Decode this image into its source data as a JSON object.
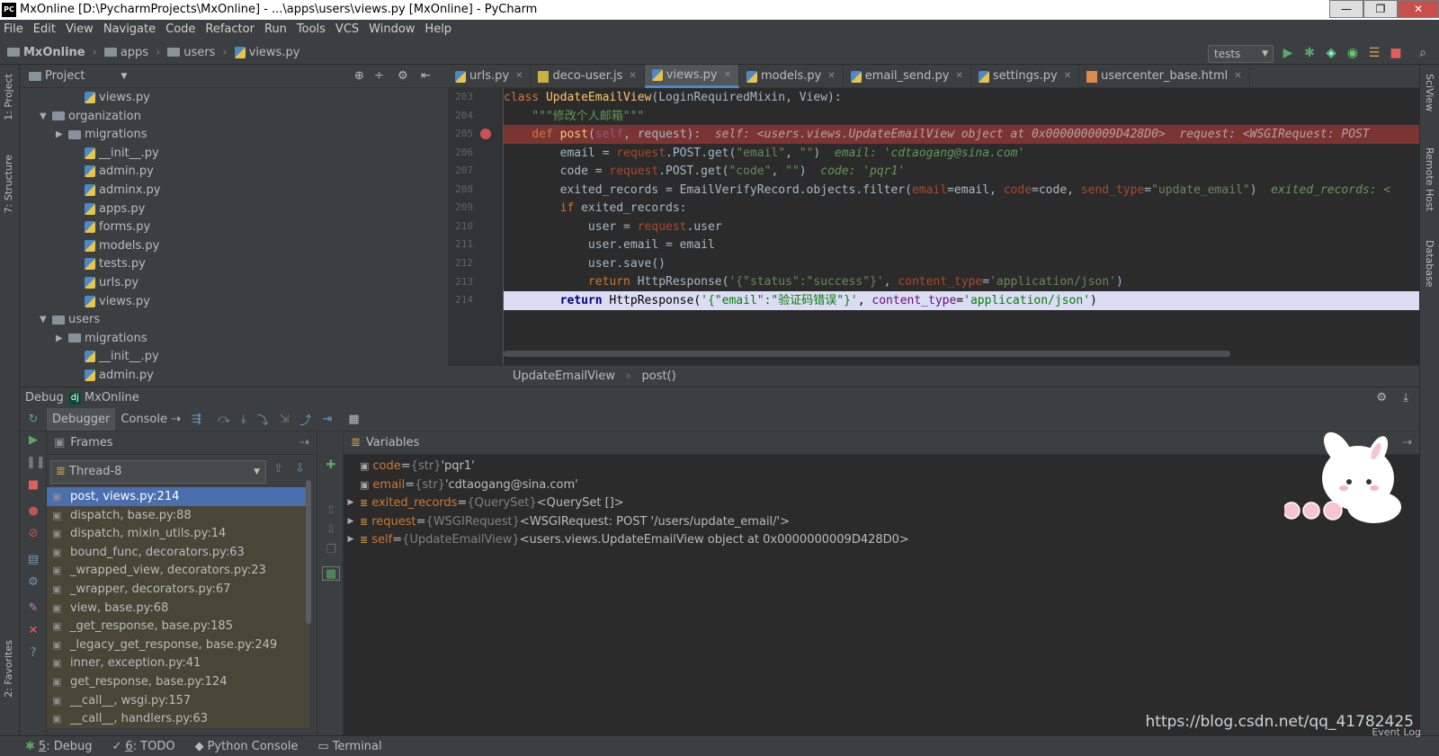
{
  "window": {
    "title": "MxOnline [D:\\PycharmProjects\\MxOnline] - ...\\apps\\users\\views.py [MxOnline] - PyCharm",
    "logo": "PC",
    "min": "—",
    "max": "❐",
    "close": "✕"
  },
  "menu": [
    "File",
    "Edit",
    "View",
    "Navigate",
    "Code",
    "Refactor",
    "Run",
    "Tools",
    "VCS",
    "Window",
    "Help"
  ],
  "breadcrumb": [
    "MxOnline",
    "apps",
    "users",
    "views.py"
  ],
  "run_config": "tests",
  "left_strip": {
    "project": "1: Project",
    "structure": "7: Structure",
    "favorites": "2: Favorites"
  },
  "right_strip": {
    "sciview": "SciView",
    "remote_host": "Remote Host",
    "database": "Database"
  },
  "project_panel": {
    "title": "Project"
  },
  "tree": [
    {
      "label": "views.py",
      "kind": "py",
      "indent": 4
    },
    {
      "label": "organization",
      "kind": "folder",
      "indent": 2,
      "arrow": "▼"
    },
    {
      "label": "migrations",
      "kind": "folder",
      "indent": 3,
      "arrow": "▶"
    },
    {
      "label": "__init__.py",
      "kind": "py",
      "indent": 4
    },
    {
      "label": "admin.py",
      "kind": "py",
      "indent": 4
    },
    {
      "label": "adminx.py",
      "kind": "py",
      "indent": 4
    },
    {
      "label": "apps.py",
      "kind": "py",
      "indent": 4
    },
    {
      "label": "forms.py",
      "kind": "py",
      "indent": 4
    },
    {
      "label": "models.py",
      "kind": "py",
      "indent": 4
    },
    {
      "label": "tests.py",
      "kind": "py",
      "indent": 4
    },
    {
      "label": "urls.py",
      "kind": "py",
      "indent": 4
    },
    {
      "label": "views.py",
      "kind": "py",
      "indent": 4
    },
    {
      "label": "users",
      "kind": "folder",
      "indent": 2,
      "arrow": "▼"
    },
    {
      "label": "migrations",
      "kind": "folder",
      "indent": 3,
      "arrow": "▶"
    },
    {
      "label": "__init__.py",
      "kind": "py",
      "indent": 4
    },
    {
      "label": "admin.py",
      "kind": "py",
      "indent": 4
    }
  ],
  "tabs": [
    {
      "label": "urls.py",
      "kind": "py"
    },
    {
      "label": "deco-user.js",
      "kind": "js"
    },
    {
      "label": "views.py",
      "kind": "py",
      "active": true
    },
    {
      "label": "models.py",
      "kind": "py"
    },
    {
      "label": "email_send.py",
      "kind": "py"
    },
    {
      "label": "settings.py",
      "kind": "py"
    },
    {
      "label": "usercenter_base.html",
      "kind": "html"
    }
  ],
  "line_numbers": [
    "203",
    "204",
    "205",
    "206",
    "207",
    "208",
    "209",
    "210",
    "211",
    "212",
    "213",
    "214"
  ],
  "code": {
    "l203": {
      "kw": "class ",
      "name": "UpdateEmailView",
      "rest": "(LoginRequiredMixin, View):"
    },
    "l204": {
      "doc": "    \"\"\"修改个人邮箱\"\"\""
    },
    "l205": {
      "kw": "    def ",
      "name": "post",
      "open": "(",
      "self": "self",
      "mid": ", request):",
      "hint": "  self: <users.views.UpdateEmailView object at 0x0000000009D428D0>  request: <WSGIRequest: POST"
    },
    "l206": {
      "a": "        email = ",
      "b": "request",
      "c": ".POST.get(",
      "d": "\"email\"",
      "e": ", ",
      "f": "\"\"",
      "g": ")",
      "hint": "  email: 'cdtaogang@sina.com'"
    },
    "l207": {
      "a": "        code = ",
      "b": "request",
      "c": ".POST.get(",
      "d": "\"code\"",
      "e": ", ",
      "f": "\"\"",
      "g": ")",
      "hint": "  code: 'pqr1'"
    },
    "l208": {
      "a": "        exited_records = EmailVerifyRecord.objects.filter(",
      "p1": "email",
      "b": "=email, ",
      "p2": "code",
      "c": "=code, ",
      "p3": "send_type",
      "d": "=",
      "s": "\"update_email\"",
      "e": ")",
      "hint": "  exited_records: <"
    },
    "l209": {
      "kw": "        if ",
      "rest": "exited_records:"
    },
    "l210": {
      "a": "            user = ",
      "b": "request",
      "c": ".user"
    },
    "l211": {
      "a": "            user.email = email"
    },
    "l212": {
      "a": "            user.save()"
    },
    "l213": {
      "kw": "            return ",
      "a": "HttpResponse(",
      "s": "'{\"status\":\"success\"}'",
      "b": ", ",
      "p": "content_type",
      "c": "=",
      "s2": "'application/json'",
      "d": ")"
    },
    "l214": {
      "kw": "        return ",
      "a": "HttpResponse(",
      "s": "'{\"email\":\"验证码错误\"}'",
      "b": ", ",
      "p": "content_type",
      "c": "=",
      "s2": "'application/json'",
      "d": ")"
    }
  },
  "editor_breadcrumb": {
    "cls": "UpdateEmailView",
    "sep": "›",
    "fn": "post()"
  },
  "debug": {
    "label": "Debug",
    "config": "MxOnline",
    "tab_debugger": "Debugger",
    "tab_console": "Console",
    "frames": "Frames",
    "variables": "Variables",
    "thread": "Thread-8"
  },
  "frames": [
    {
      "label": "post, views.py:214",
      "state": "sel"
    },
    {
      "label": "dispatch, base.py:88",
      "state": "lib"
    },
    {
      "label": "dispatch, mixin_utils.py:14",
      "state": "lib"
    },
    {
      "label": "bound_func, decorators.py:63",
      "state": "lib"
    },
    {
      "label": "_wrapped_view, decorators.py:23",
      "state": "lib"
    },
    {
      "label": "_wrapper, decorators.py:67",
      "state": "lib"
    },
    {
      "label": "view, base.py:68",
      "state": "lib"
    },
    {
      "label": "_get_response, base.py:185",
      "state": "lib"
    },
    {
      "label": "_legacy_get_response, base.py:249",
      "state": "lib"
    },
    {
      "label": "inner, exception.py:41",
      "state": "lib"
    },
    {
      "label": "get_response, base.py:124",
      "state": "lib"
    },
    {
      "label": "__call__, wsgi.py:157",
      "state": "lib"
    },
    {
      "label": "__call__, handlers.py:63",
      "state": "lib"
    }
  ],
  "variables": [
    {
      "name": "code",
      "type": "{str}",
      "value": "'pqr1'",
      "expand": "",
      "kind": "str"
    },
    {
      "name": "email",
      "type": "{str}",
      "value": "'cdtaogang@sina.com'",
      "expand": "",
      "kind": "str"
    },
    {
      "name": "exited_records",
      "type": "{QuerySet}",
      "value": "<QuerySet []>",
      "expand": "▶",
      "kind": "obj"
    },
    {
      "name": "request",
      "type": "{WSGIRequest}",
      "value": "<WSGIRequest: POST '/users/update_email/'>",
      "expand": "▶",
      "kind": "obj"
    },
    {
      "name": "self",
      "type": "{UpdateEmailView}",
      "value": "<users.views.UpdateEmailView object at 0x0000000009D428D0>",
      "expand": "▶",
      "kind": "obj"
    }
  ],
  "statusbar": [
    {
      "num": "5",
      "label": ": Debug"
    },
    {
      "num": "6",
      "label": ": TODO"
    },
    {
      "num": "",
      "label": "Python Console"
    },
    {
      "num": "",
      "label": "Terminal"
    }
  ],
  "watermark": "https://blog.csdn.net/qq_41782425",
  "event_log": "Event Log",
  "colors": {
    "bg": "#3c3f41",
    "editor": "#2b2b2b",
    "selection": "#4b6eaf",
    "breakpoint_line": "#7c3432",
    "current_line": "#d8d8f5"
  }
}
